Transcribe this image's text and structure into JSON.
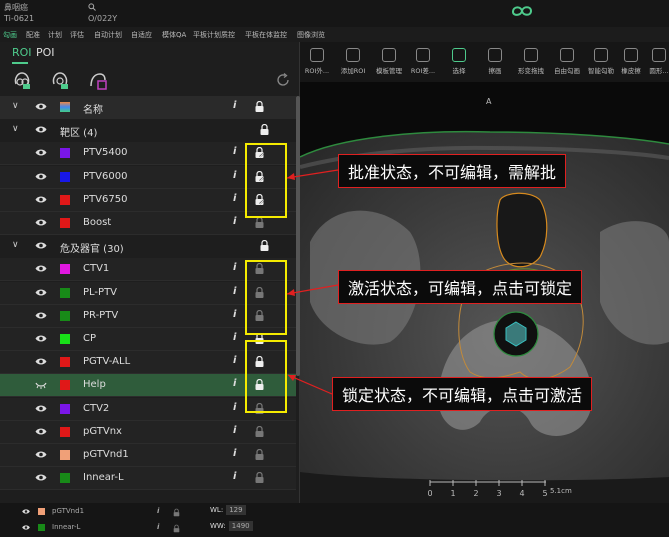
{
  "topbar": {
    "title": "鼻咽癌",
    "patient_id": "Ti-0621",
    "search_icon": "search-icon",
    "case_id": "O/022Y"
  },
  "menubar": {
    "items": [
      "勾画",
      "配准",
      "计划",
      "评估",
      "自动计划",
      "自适应",
      "模体QA",
      "平板计划质控",
      "平板在体监控",
      "图像浏览"
    ],
    "active_index": 0
  },
  "toolbar": {
    "tools": [
      "ROI外...",
      "添加ROI",
      "模板管理",
      "ROI差...",
      "选择",
      "擦画",
      "形变拖拽",
      "自由勾画",
      "智能勾勒",
      "橡皮擦",
      "圆形..."
    ],
    "selected_index": 4
  },
  "viewer": {
    "orientation": "A",
    "scale_ticks": [
      "0",
      "1",
      "2",
      "3",
      "4",
      "5"
    ],
    "scale_unit": "5.1cm"
  },
  "panel": {
    "tabs": [
      "ROI",
      "POI"
    ],
    "active_tab": 0,
    "tool_icons": [
      "roi-add-icon",
      "roi-template-icon",
      "roi-edit-icon"
    ],
    "refresh_icon": "refresh-icon",
    "column_header": {
      "name": "名称"
    },
    "groups": [
      {
        "label": "靶区 (4)"
      },
      {
        "label": "危及器官 (30)"
      }
    ],
    "rows": [
      {
        "name": "PTV5400",
        "color": "#7a16e8",
        "lock": "approved"
      },
      {
        "name": "PTV6000",
        "color": "#1818e8",
        "lock": "approved"
      },
      {
        "name": "PTV6750",
        "color": "#e01818",
        "lock": "approved"
      },
      {
        "name": "Boost",
        "color": "#e01818",
        "lock": "active"
      },
      {
        "name": "CTV1",
        "color": "#e018e0",
        "lock": "active"
      },
      {
        "name": "PL-PTV",
        "color": "#188a18",
        "lock": "active"
      },
      {
        "name": "PR-PTV",
        "color": "#188a18",
        "lock": "active"
      },
      {
        "name": "CP",
        "color": "#18e018",
        "lock": "locked"
      },
      {
        "name": "PGTV-ALL",
        "color": "#e01818",
        "lock": "locked"
      },
      {
        "name": "Help",
        "color": "#e01818",
        "lock": "locked"
      },
      {
        "name": "CTV2",
        "color": "#7a16e8",
        "lock": "active"
      },
      {
        "name": "pGTVnx",
        "color": "#e01818",
        "lock": "active"
      },
      {
        "name": "pGTVnd1",
        "color": "#f0a078",
        "lock": "active"
      },
      {
        "name": "Innear-L",
        "color": "#188a18",
        "lock": "active"
      }
    ]
  },
  "callouts": {
    "approved": "批准状态，不可编辑，需解批",
    "active": "激活状态，可编辑，点击可锁定",
    "locked": "锁定状态，不可编辑，点击可激活"
  },
  "bottom": {
    "rows": [
      {
        "name": "pGTVnd1",
        "color": "#f0a078"
      },
      {
        "name": "Innear-L",
        "color": "#188a18"
      }
    ],
    "wl_label": "WL:",
    "wl_value": "129",
    "ww_label": "WW:",
    "ww_value": "1490"
  },
  "colors": {
    "accent": "#4ecb8c",
    "highlight": "#f5eb00",
    "callout_border": "#e02020"
  }
}
